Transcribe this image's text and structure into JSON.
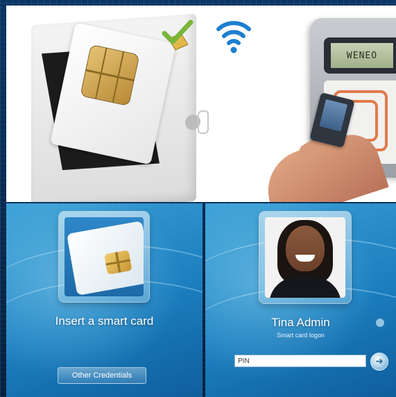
{
  "terminal": {
    "screen_text": "WENEO"
  },
  "icons": {
    "check": "checkmark-card-icon",
    "wireless": "wifi-icon",
    "submit": "arrow-right-icon"
  },
  "smartcard_panel": {
    "prompt": "Insert a smart card",
    "other_credentials_label": "Other Credentials"
  },
  "user_panel": {
    "user_name": "Tina Admin",
    "logon_type": "Smart card logon",
    "pin_placeholder": "PIN"
  },
  "colors": {
    "accent_blue": "#1c7fc0",
    "rfid_orange": "#e07a4a",
    "check_green": "#7ab63a"
  }
}
